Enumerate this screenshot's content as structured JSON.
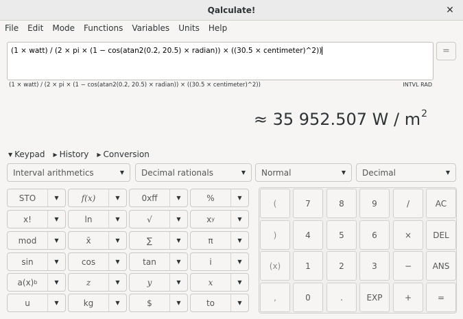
{
  "window": {
    "title": "Qalculate!"
  },
  "menu": [
    "File",
    "Edit",
    "Mode",
    "Functions",
    "Variables",
    "Units",
    "Help"
  ],
  "expression": {
    "input": "(1 × watt) / (2 × pi × (1 − cos(atan2(0.2, 20.5) × radian)) × ((30.5 × centimeter)^2))",
    "equals_label": "=",
    "parsed": "(1 × watt) / (2 × pi × (1 − cos(atan2(0.2, 20.5) × radian)) × ((30.5 × centimeter)^2))",
    "mode_indicator": "INTVL RAD"
  },
  "result": {
    "text": "≈ 35 952.507 W / m",
    "exponent": "2"
  },
  "expanders": {
    "keypad": "Keypad",
    "history": "History",
    "conversion": "Conversion"
  },
  "selectors": {
    "interval": "Interval arithmetics",
    "rationals": "Decimal rationals",
    "display": "Normal",
    "base": "Decimal"
  },
  "function_buttons": {
    "sto": "STO",
    "fx": "f(x)",
    "xff": "0xff",
    "percent": "%",
    "factorial": "x!",
    "ln": "ln",
    "sqrt": "√",
    "power_base": "x",
    "power_exp": "y",
    "mod": "mod",
    "mean": "x̄",
    "sum": "∑",
    "pi": "π",
    "sin": "sin",
    "cos": "cos",
    "tan": "tan",
    "imag": "i",
    "ax_base": "a(x)",
    "ax_exp": "b",
    "z": "z",
    "y": "y",
    "x": "x",
    "u": "u",
    "kg": "kg",
    "dollar": "$",
    "to": "to"
  },
  "keypad": {
    "lparen": "(",
    "rparen": ")",
    "paren_x": "(x)",
    "comma": ",",
    "d7": "7",
    "d8": "8",
    "d9": "9",
    "divide": "/",
    "ac": "AC",
    "d4": "4",
    "d5": "5",
    "d6": "6",
    "multiply": "×",
    "del": "DEL",
    "d1": "1",
    "d2": "2",
    "d3": "3",
    "minus": "−",
    "ans": "ANS",
    "d0": "0",
    "dot": ".",
    "exp": "EXP",
    "plus": "+",
    "equals": "="
  }
}
